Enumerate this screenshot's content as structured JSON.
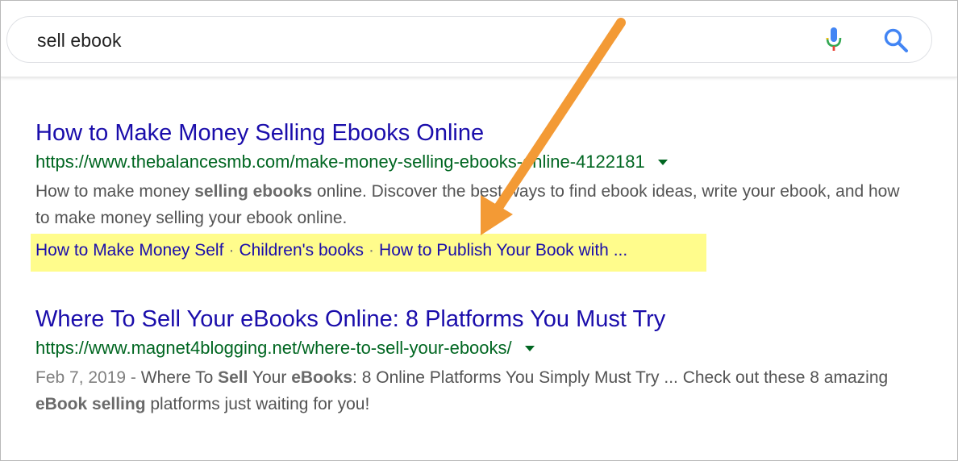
{
  "search": {
    "query": "sell ebook"
  },
  "results": [
    {
      "title": "How to Make Money Selling Ebooks Online",
      "url": "https://www.thebalancesmb.com/make-money-selling-ebooks-online-4122181",
      "snippet_parts": [
        {
          "text": "How to make money ",
          "bold": false
        },
        {
          "text": "selling ebooks",
          "bold": true
        },
        {
          "text": " online. Discover the best ways to find ebook ideas, write your ebook, and how to make money selling your ebook online.",
          "bold": false
        }
      ],
      "sitelinks": [
        "How to Make Money Self",
        "Children's books",
        "How to Publish Your Book with ..."
      ]
    },
    {
      "title": "Where To Sell Your eBooks Online: 8 Platforms You Must Try",
      "url": "https://www.magnet4blogging.net/where-to-sell-your-ebooks/",
      "date": "Feb 7, 2019",
      "snippet_parts": [
        {
          "text": "Where To ",
          "bold": false
        },
        {
          "text": "Sell",
          "bold": true
        },
        {
          "text": " Your ",
          "bold": false
        },
        {
          "text": "eBooks",
          "bold": true
        },
        {
          "text": ": 8 Online Platforms You Simply Must Try ... Check out these 8 amazing ",
          "bold": false
        },
        {
          "text": "eBook selling",
          "bold": true
        },
        {
          "text": " platforms just waiting for you!",
          "bold": false
        }
      ]
    }
  ],
  "colors": {
    "title_link": "#1a0dab",
    "url_green": "#006621",
    "snippet_gray": "#545454",
    "highlight_yellow": "#fffc8c",
    "arrow_orange": "#f39a35"
  },
  "labels": {
    "sitelink_separator": "·",
    "date_separator": " - "
  },
  "icons": {
    "mic": "mic-icon",
    "search": "search-icon",
    "caret": "caret-down-icon",
    "annotation": "arrow-annotation"
  }
}
